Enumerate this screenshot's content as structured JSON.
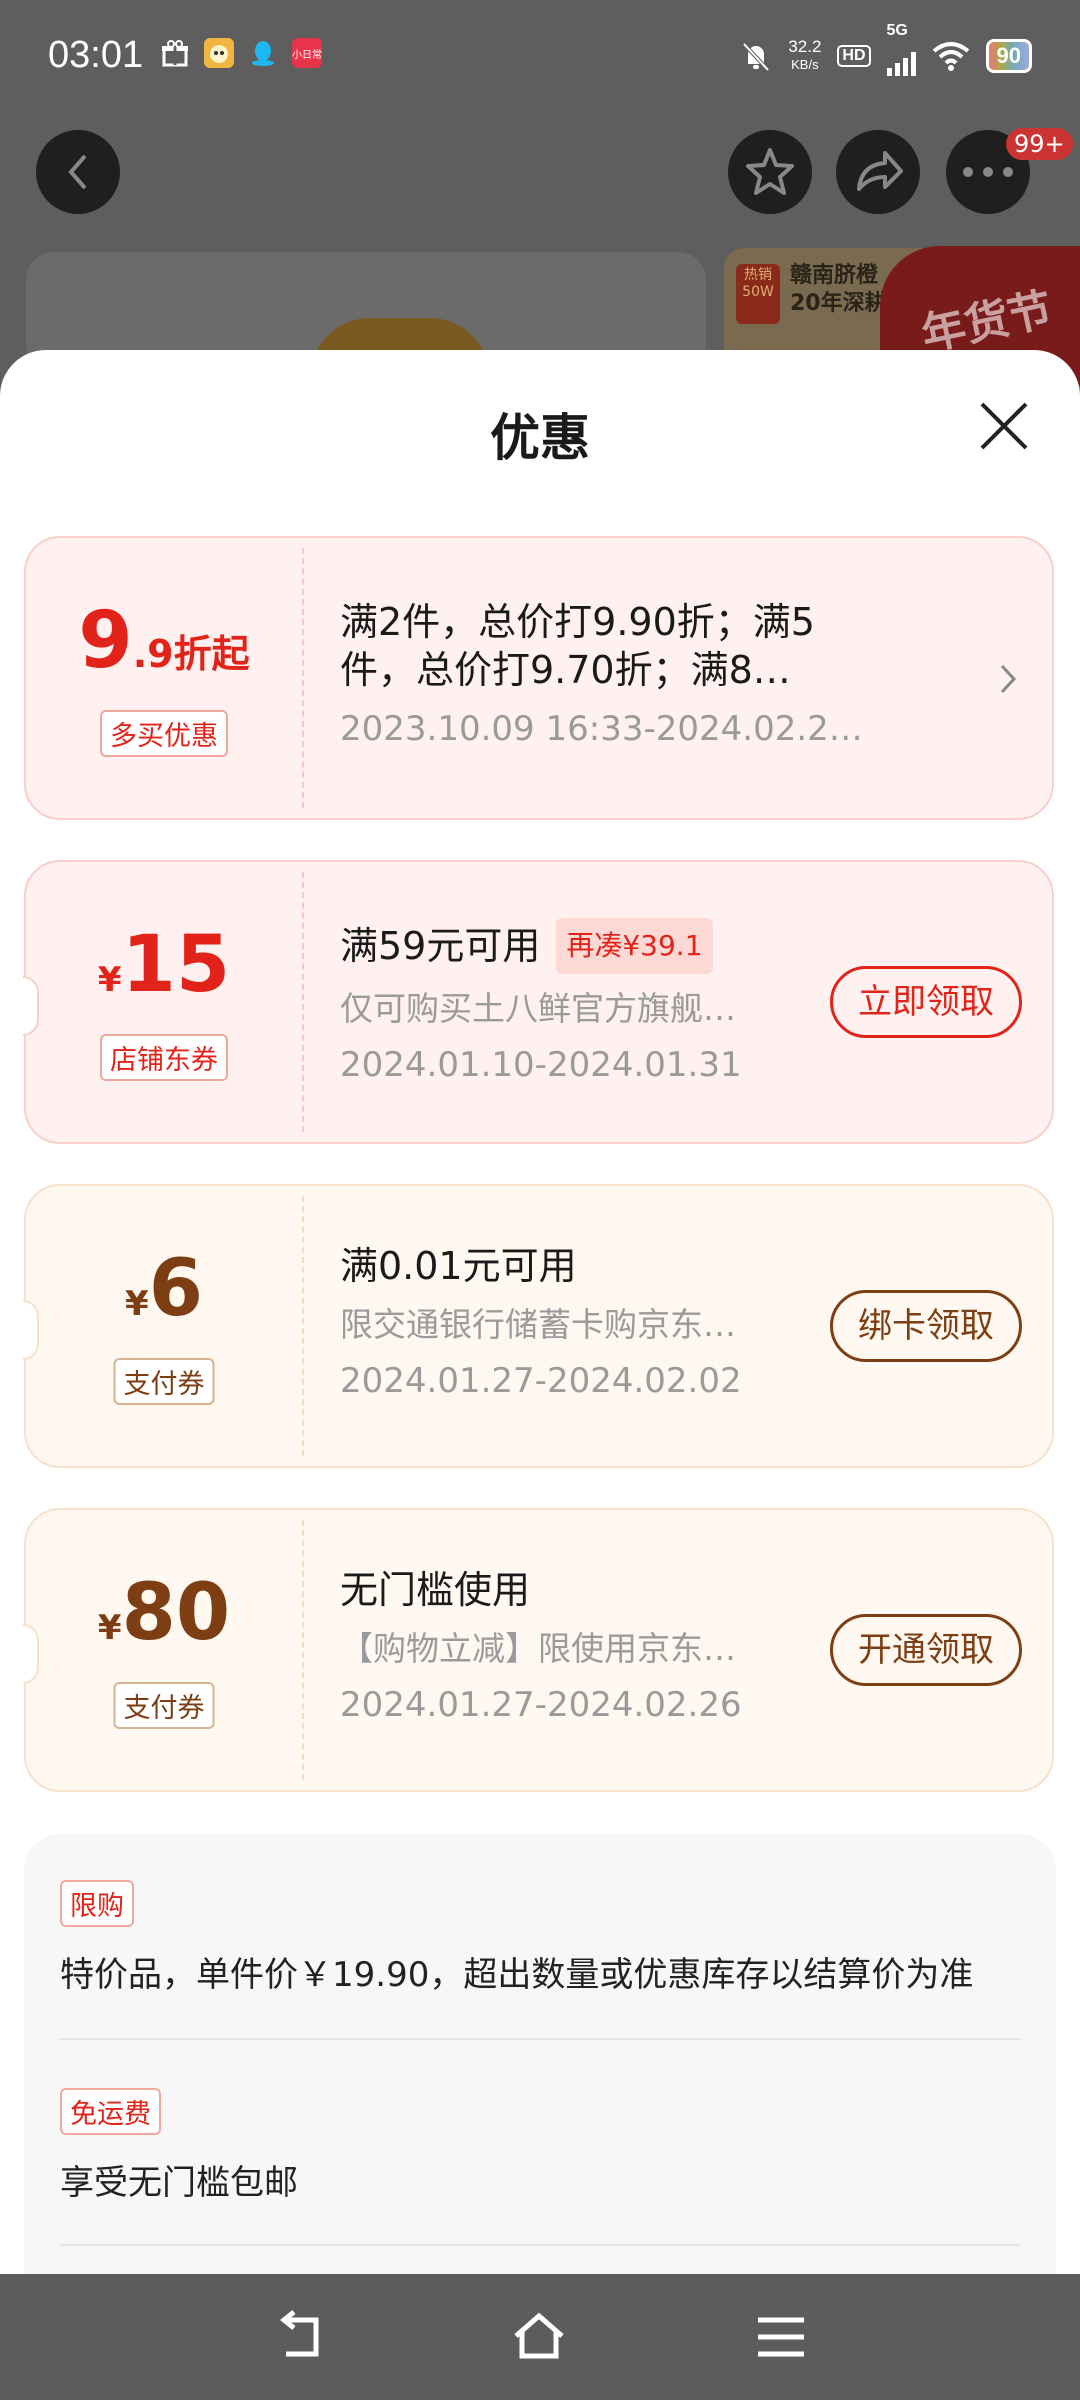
{
  "status_bar": {
    "time": "03:01",
    "net_speed_value": "32.2",
    "net_speed_unit": "KB/s",
    "hd": "HD",
    "network": "5G",
    "battery": "90",
    "app_icon_label": "小日常"
  },
  "background_page": {
    "badge": "99+",
    "promo_line1": "赣南脐橙",
    "promo_line2": "20年深耕",
    "promo_seal_line1": "热销",
    "promo_seal_line2": "50W",
    "promo_red": "年货节"
  },
  "sheet": {
    "title": "优惠"
  },
  "coupons": [
    {
      "amount_big": "9",
      "amount_small": ".9折起",
      "tag": "多买优惠",
      "title": "满2件，总价打9.90折；满5件，总价打9.70折；满8…",
      "date": "2023.10.09 16:33-2024.02.2…"
    },
    {
      "currency": "¥",
      "amount": "15",
      "tag": "店铺东券",
      "title": "满59元可用",
      "badge": "再凑¥39.1",
      "desc": "仅可购买土八鲜官方旗舰…",
      "date": "2024.01.10-2024.01.31",
      "button": "立即领取"
    },
    {
      "currency": "¥",
      "amount": "6",
      "tag": "支付券",
      "title": "满0.01元可用",
      "desc": "限交通银行储蓄卡购京东…",
      "date": "2024.01.27-2024.02.02",
      "button": "绑卡领取"
    },
    {
      "currency": "¥",
      "amount": "80",
      "tag": "支付券",
      "title": "无门槛使用",
      "desc": "【购物立减】限使用京东…",
      "date": "2024.01.27-2024.02.26",
      "button": "开通领取"
    }
  ],
  "rules": [
    {
      "tag": "限购",
      "text": "特价品，单件价￥19.90，超出数量或优惠库存以结算价为准"
    },
    {
      "tag": "免运费",
      "text": "享受无门槛包邮"
    }
  ],
  "colors": {
    "accent_red": "#e2231a",
    "accent_brown": "#7c3e12",
    "sheet_bg": "#ffffff",
    "overlay": "#5e5e5e"
  }
}
